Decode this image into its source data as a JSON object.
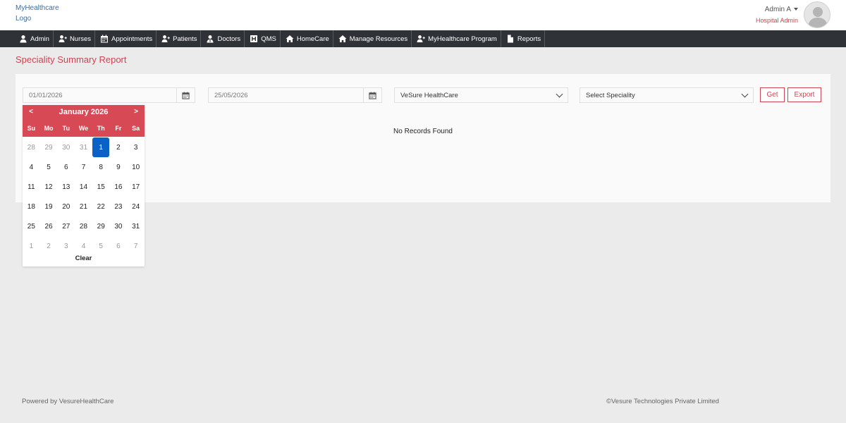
{
  "header": {
    "logo_line1": "MyHealthcare",
    "logo_line2": "Logo",
    "user_name": "Admin A",
    "user_role": "Hospital Admin"
  },
  "nav": [
    {
      "label": "Admin",
      "icon": "user-icon"
    },
    {
      "label": "Nurses",
      "icon": "user-plus-icon"
    },
    {
      "label": "Appointments",
      "icon": "calendar-icon"
    },
    {
      "label": "Patients",
      "icon": "user-plus-icon"
    },
    {
      "label": "Doctors",
      "icon": "doctor-icon"
    },
    {
      "label": "QMS",
      "icon": "hospital-icon"
    },
    {
      "label": "HomeCare",
      "icon": "home-icon"
    },
    {
      "label": "Manage Resources",
      "icon": "home-icon"
    },
    {
      "label": "MyHealthcare Program",
      "icon": "user-plus-icon"
    },
    {
      "label": "Reports",
      "icon": "file-icon"
    }
  ],
  "page": {
    "title": "Speciality Summary Report",
    "from_date": "01/01/2026",
    "to_date": "25/05/2026",
    "hospital_select": "VeSure HealthCare",
    "speciality_select": "Select Speciality",
    "get_label": "Get",
    "export_label": "Export",
    "empty_message": "No Records Found"
  },
  "datepicker": {
    "prev": "<",
    "next": ">",
    "month_label": "January 2026",
    "dows": [
      "Su",
      "Mo",
      "Tu",
      "We",
      "Th",
      "Fr",
      "Sa"
    ],
    "weeks": [
      [
        "28",
        "29",
        "30",
        "31",
        "1",
        "2",
        "3"
      ],
      [
        "4",
        "5",
        "6",
        "7",
        "8",
        "9",
        "10"
      ],
      [
        "11",
        "12",
        "13",
        "14",
        "15",
        "16",
        "17"
      ],
      [
        "18",
        "19",
        "20",
        "21",
        "22",
        "23",
        "24"
      ],
      [
        "25",
        "26",
        "27",
        "28",
        "29",
        "30",
        "31"
      ],
      [
        "1",
        "2",
        "3",
        "4",
        "5",
        "6",
        "7"
      ]
    ],
    "selected_day": "1",
    "clear_label": "Clear"
  },
  "footer": {
    "left": "Powered by VesureHealthCare",
    "right": "©Vesure Technologies Private Limited"
  },
  "colors": {
    "accent": "#c94652",
    "nav_bg": "#2f3338",
    "selected_day": "#0a62c7"
  }
}
